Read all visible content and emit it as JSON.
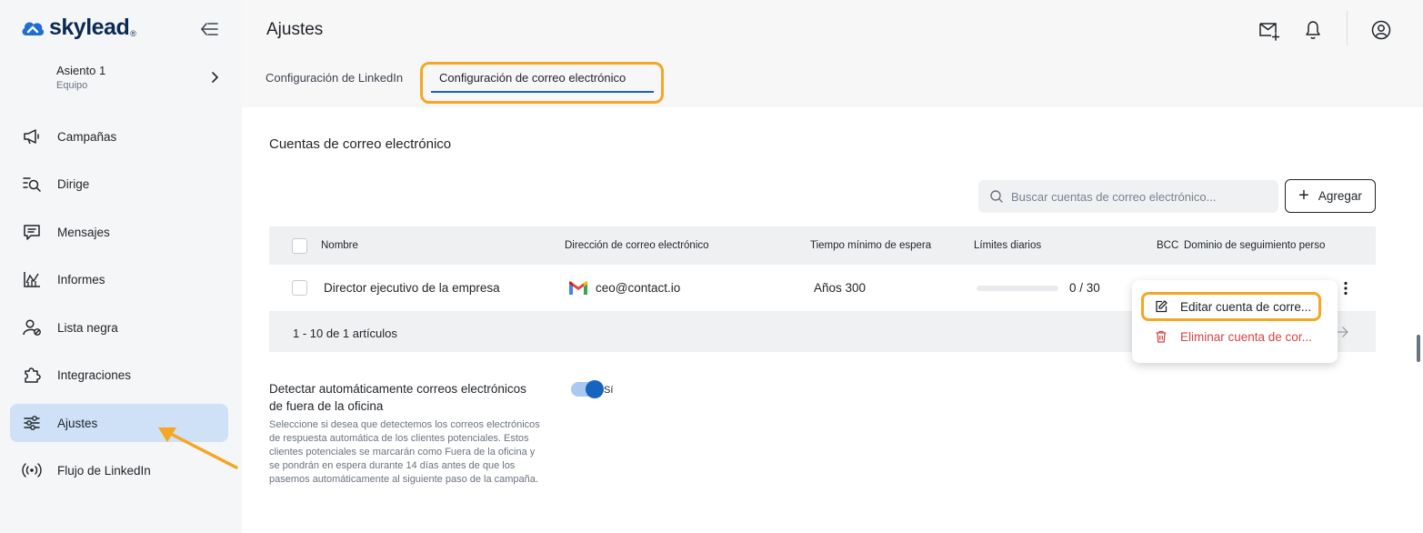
{
  "app": {
    "logo_text": "skylead",
    "logo_mark": "®",
    "brand_color": "#1f6fd1"
  },
  "sidebar": {
    "seat": {
      "name": "Asiento 1",
      "sub": "Equipo"
    },
    "items": [
      {
        "label": "Campañas",
        "icon": "megaphone-icon"
      },
      {
        "label": "Dirige",
        "icon": "leads-search-icon"
      },
      {
        "label": "Mensajes",
        "icon": "message-icon"
      },
      {
        "label": "Informes",
        "icon": "chart-icon"
      },
      {
        "label": "Lista negra",
        "icon": "user-blocked-icon"
      },
      {
        "label": "Integraciones",
        "icon": "puzzle-icon"
      },
      {
        "label": "Ajustes",
        "icon": "sliders-icon",
        "active": true
      },
      {
        "label": "Flujo de LinkedIn",
        "icon": "broadcast-icon"
      }
    ]
  },
  "header": {
    "title": "Ajustes",
    "icons": [
      "mail-plus-icon",
      "bell-icon",
      "user-circle-icon"
    ]
  },
  "tabs": [
    {
      "label": "Configuración de LinkedIn"
    },
    {
      "label": "Configuración de correo electrónico",
      "active": true
    }
  ],
  "email_section": {
    "title": "Cuentas de correo electrónico",
    "search_placeholder": "Buscar cuentas de correo electrónico...",
    "add_label": "Agregar",
    "columns": {
      "name": "Nombre",
      "email": "Dirección de correo electrónico",
      "wait": "Tiempo mínimo de espera",
      "limits": "Límites diarios",
      "bcc": "BCC",
      "domain": "Dominio de seguimiento perso"
    },
    "rows": [
      {
        "name": "Director ejecutivo de la empresa",
        "email": "ceo@contact.io",
        "wait": "Años 300",
        "limit_text": "0 / 30",
        "limit_fraction": 0
      }
    ],
    "pagination": "1 - 10 de 1 artículos"
  },
  "auto_detect": {
    "title": "Detectar automáticamente correos electrónicos de fuera de la oficina",
    "description": "Seleccione si desea que detectemos los correos electrónicos de respuesta automática de los clientes potenciales. Estos clientes potenciales se marcarán como Fuera de la oficina y se pondrán en espera durante 14 días antes de que los pasemos automáticamente al siguiente paso de la campaña.",
    "toggle_label": "Sí",
    "enabled": true
  },
  "context_menu": {
    "edit_label": "Editar cuenta de corre...",
    "delete_label": "Eliminar cuenta de cor...",
    "delete_color": "#d64545"
  }
}
